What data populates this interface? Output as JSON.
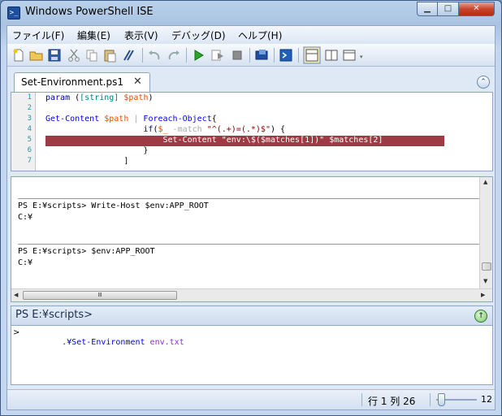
{
  "window": {
    "title": "Windows PowerShell ISE",
    "icon": "powershell-icon"
  },
  "caption": {
    "minimize": "▁",
    "maximize": "□",
    "close": "✕"
  },
  "menu": [
    "ファイル(F)",
    "編集(E)",
    "表示(V)",
    "デバッグ(D)",
    "ヘルプ(H)"
  ],
  "toolbar": {
    "icons": [
      "new-file-icon",
      "open-folder-icon",
      "save-icon",
      "cut-icon",
      "copy-icon",
      "paste-icon",
      "clear-icon",
      "undo-icon",
      "redo-icon",
      "run-icon",
      "run-selection-icon",
      "stop-icon",
      "remote-tab-icon",
      "powershell-console-icon",
      "layout-top-icon",
      "layout-right-icon",
      "layout-max-icon"
    ]
  },
  "tab": {
    "label": "Set-Environment.ps1",
    "close": "✕"
  },
  "editor": {
    "line_numbers": [
      "1",
      "2",
      "3",
      "4",
      "5",
      "6",
      "7"
    ],
    "highlighted_line": 5,
    "lines": [
      [
        {
          "t": "param ",
          "c": "kw"
        },
        {
          "t": "(",
          "c": "plain"
        },
        {
          "t": "[string]",
          "c": "ty"
        },
        {
          "t": " ",
          "c": "plain"
        },
        {
          "t": "$path",
          "c": "var"
        },
        {
          "t": ")",
          "c": "plain"
        }
      ],
      [],
      [
        {
          "t": "Get-Content ",
          "c": "cmd"
        },
        {
          "t": "$path",
          "c": "var"
        },
        {
          "t": " | ",
          "c": "op"
        },
        {
          "t": "Foreach-Object",
          "c": "cmd"
        },
        {
          "t": "{",
          "c": "plain"
        }
      ],
      [
        {
          "t": "                    if",
          "c": "kw"
        },
        {
          "t": "(",
          "c": "plain"
        },
        {
          "t": "$_",
          "c": "var"
        },
        {
          "t": " -match ",
          "c": "op"
        },
        {
          "t": "\"^(.+)=(.*)$\"",
          "c": "str"
        },
        {
          "t": ")",
          "c": "plain"
        },
        {
          "t": " {",
          "c": "plain"
        }
      ],
      [
        {
          "t": "                        Set-Content \"env:\\$($matches[1])\" $matches[2]",
          "c": "wht"
        }
      ],
      [
        {
          "t": "                    }",
          "c": "plain"
        }
      ],
      [
        {
          "t": "                ]",
          "c": "plain"
        }
      ]
    ]
  },
  "output": {
    "blocks": [
      {
        "prompt": "PS E:¥scripts> Write-Host $env:APP_ROOT",
        "result": "C:¥"
      },
      {
        "prompt": "PS E:¥scripts> $env:APP_ROOT",
        "result": "C:¥"
      }
    ],
    "hscroll_thumb": "Ⅲ"
  },
  "command": {
    "header": "PS E:¥scripts>",
    "glyph": ">",
    "input": [
      {
        "t": ".¥Set-Environment ",
        "c": "cmd"
      },
      {
        "t": "env.txt",
        "c": "kw2"
      }
    ],
    "run_glyph": "↑"
  },
  "status": {
    "position": "行 1 列 26",
    "zoom": "12"
  }
}
